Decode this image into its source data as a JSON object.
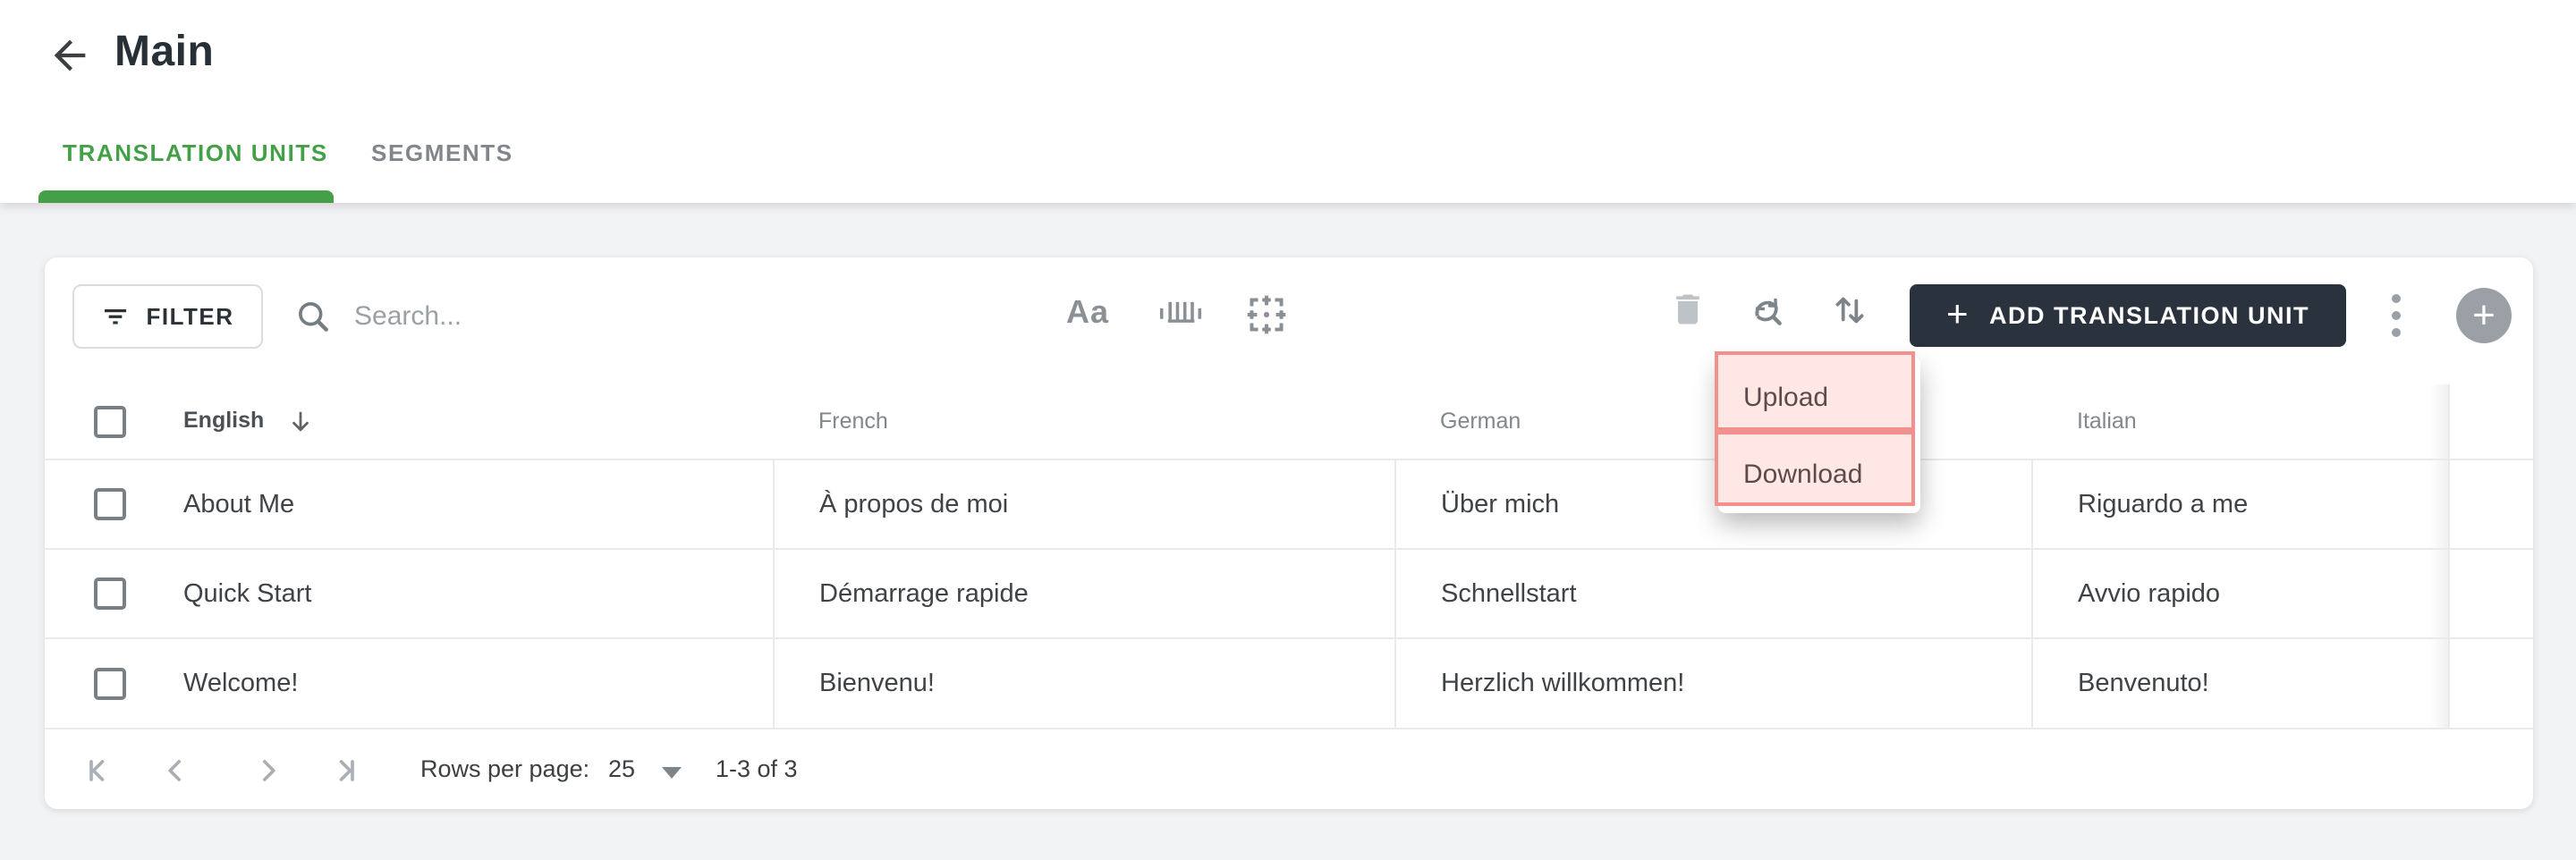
{
  "header": {
    "title": "Main"
  },
  "tabs": [
    {
      "label": "TRANSLATION UNITS",
      "active": true
    },
    {
      "label": "SEGMENTS",
      "active": false
    }
  ],
  "toolbar": {
    "filter_label": "FILTER",
    "search_placeholder": "Search...",
    "match_case_label": "Aa",
    "add_button_label": "ADD TRANSLATION UNIT",
    "add_button_plus": "+",
    "fab_plus": "+"
  },
  "menu": {
    "items": [
      "Upload",
      "Download"
    ]
  },
  "table": {
    "columns": [
      "English",
      "French",
      "German",
      "Italian"
    ],
    "sorted_column": "English",
    "sort_direction": "desc",
    "rows": [
      [
        "About Me",
        "À propos de moi",
        "Über mich",
        "Riguardo a me"
      ],
      [
        "Quick Start",
        "Démarrage rapide",
        "Schnellstart",
        "Avvio rapido"
      ],
      [
        "Welcome!",
        "Bienvenu!",
        "Herzlich willkommen!",
        "Benvenuto!"
      ]
    ]
  },
  "pagination": {
    "rows_per_page_label": "Rows per page:",
    "rows_per_page_value": "25",
    "range_label": "1-3 of 3"
  },
  "icons": {
    "back": "arrow-left",
    "filter": "filter-lines",
    "search": "magnifier",
    "match_case": "Aa",
    "barcode": "barcode",
    "frame": "crop-frame-target",
    "trash": "trash-filled",
    "refresh_search": "refresh-with-magnifier",
    "sort": "swap-vertical-arrows",
    "kebab": "vertical-dots",
    "fab": "plus-circle",
    "pagination": [
      "first-page",
      "previous-page",
      "next-page",
      "last-page"
    ]
  },
  "colors": {
    "accent_green": "#43a047",
    "dark_button": "#2a333d",
    "page_background": "#f2f3f5",
    "highlight_fill": "#ffe7e5",
    "highlight_border": "#f2908d",
    "divider": "#e9eaec"
  }
}
